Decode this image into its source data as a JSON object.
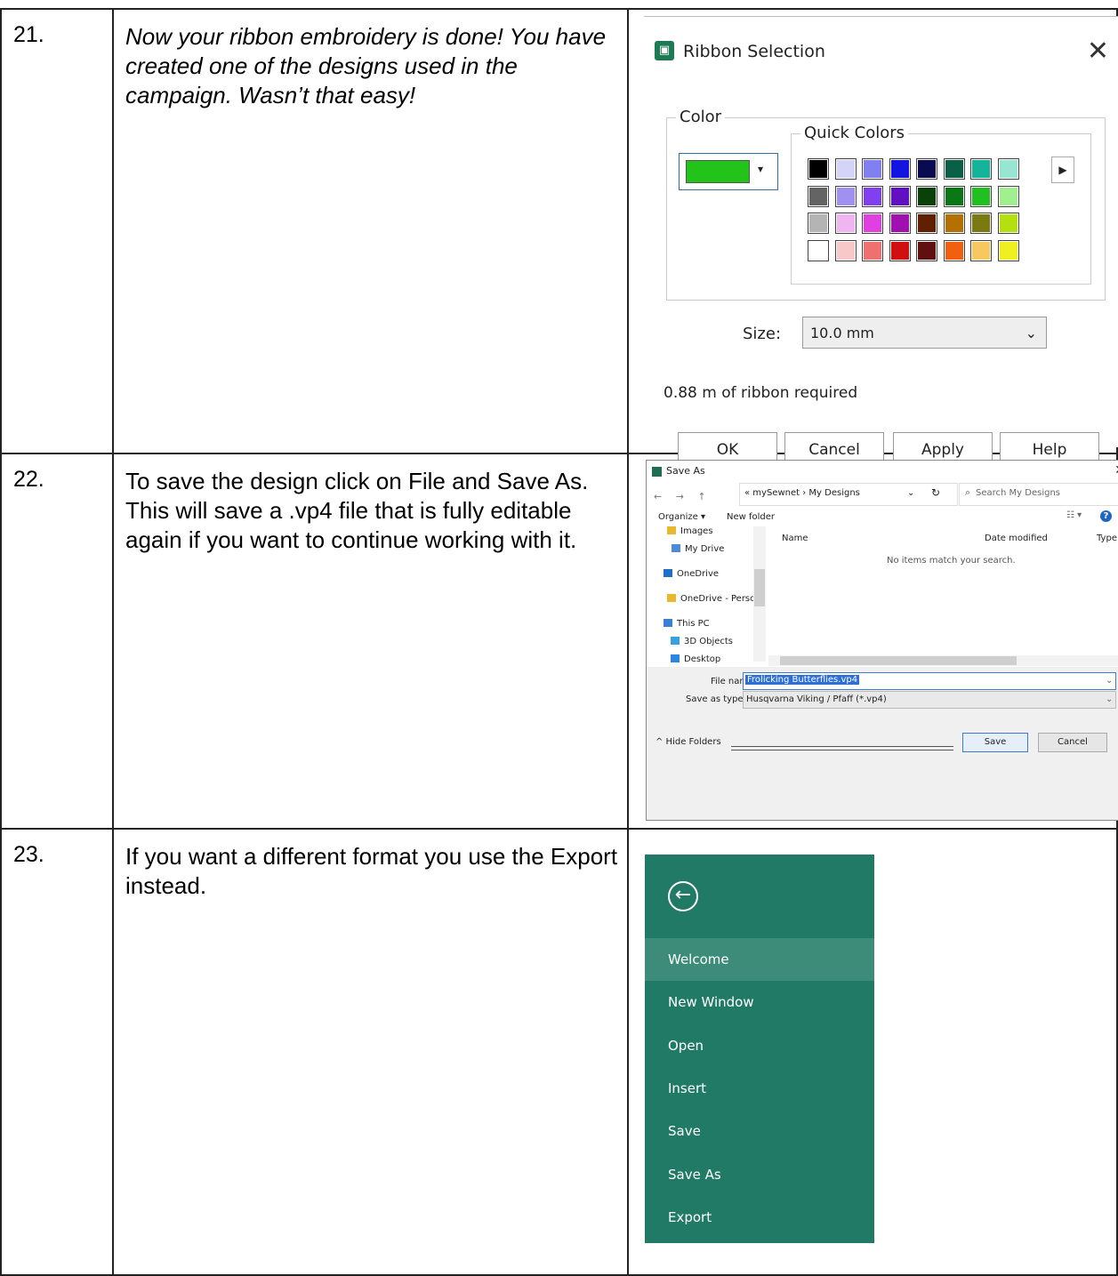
{
  "rows": [
    {
      "num": "21.",
      "text": "Now your ribbon embroidery is done! You have created one of the designs used in the campaign. Wasn’t that easy!"
    },
    {
      "num": "22.",
      "text": "To save the design click on File and Save As. This will save a .vp4 file that is fully editable again if you want to continue working with it."
    },
    {
      "num": "23.",
      "text": "If you want a different format you use the Export instead."
    }
  ],
  "ribbon_dialog": {
    "title": "Ribbon Selection",
    "close_glyph": "✕",
    "color_label": "Color",
    "quick_colors_label": "Quick Colors",
    "selected_color": "#22c41a",
    "dropdown_arrow": "▾",
    "more_arrow": "▶",
    "quick_colors": [
      "#000000",
      "#d4d4f8",
      "#8080f0",
      "#1414e0",
      "#0a0a50",
      "#0a6046",
      "#14b49a",
      "#96e6d2",
      "#646464",
      "#a090f0",
      "#8040f0",
      "#6010c0",
      "#0a400a",
      "#0a7814",
      "#20c020",
      "#a0f090",
      "#b4b4b4",
      "#f0b4f0",
      "#e040e0",
      "#a010b0",
      "#602000",
      "#b47000",
      "#7a7a10",
      "#b4e010",
      "#ffffff",
      "#f8c8c8",
      "#f07070",
      "#d01010",
      "#601010",
      "#f06010",
      "#f8c860",
      "#f0f020"
    ],
    "size_label": "Size:",
    "size_value": "10.0 mm",
    "size_chevron": "⌄",
    "required_text": "0.88 m of ribbon required",
    "buttons": {
      "ok": "OK",
      "cancel": "Cancel",
      "apply": "Apply",
      "help": "Help"
    }
  },
  "save_dialog": {
    "title": "Save As",
    "close_glyph": "✕",
    "nav_glyphs": "← → ↑",
    "address": "« mySewnet › My Designs",
    "address_chevron": "⌄",
    "refresh_glyph": "↻",
    "search_icon": "⌕",
    "search_placeholder": "Search My Designs",
    "organize": "Organize ▾",
    "new_folder": "New folder",
    "view_glyph": "☷ ▾",
    "help_glyph": "?",
    "tree": [
      {
        "label": "Images",
        "color": "#e8b830"
      },
      {
        "label": "My Drive",
        "color": "#4a8ad8"
      },
      {
        "label": "OneDrive",
        "color": "#1f6fc8"
      },
      {
        "label": "OneDrive - Person",
        "color": "#e8b830"
      },
      {
        "label": "This PC",
        "color": "#3a7fd6"
      },
      {
        "label": "3D Objects",
        "color": "#39a0e0"
      },
      {
        "label": "Desktop",
        "color": "#2a86e0"
      }
    ],
    "columns": {
      "name": "Name",
      "date": "Date modified",
      "type": "Type"
    },
    "empty_text": "No items match your search.",
    "file_name_label": "File name:",
    "file_name_value": "Frolicking Butterflies.vp4",
    "save_type_label": "Save as type:",
    "save_type_value": "Husqvarna Viking / Pfaff (*.vp4)",
    "hide_folders": "^ Hide Folders",
    "save_button": "Save",
    "cancel_button": "Cancel"
  },
  "file_menu": {
    "back_glyph": "←",
    "items": [
      "Welcome",
      "New Window",
      "Open",
      "Insert",
      "Save",
      "Save As",
      "Export"
    ],
    "active_item": "Welcome",
    "accent_color": "#217a66"
  }
}
